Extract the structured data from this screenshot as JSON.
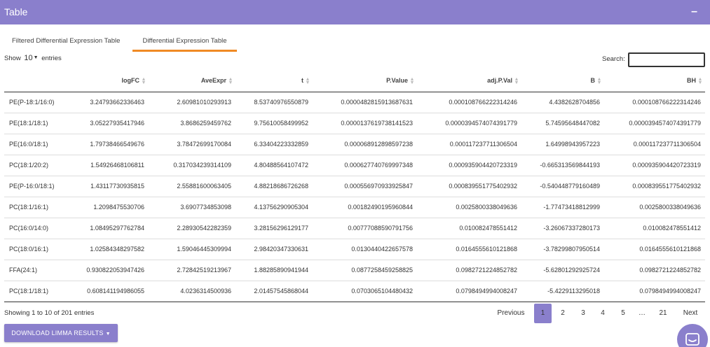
{
  "header": {
    "title": "Table",
    "collapse_icon": "minus"
  },
  "tabs": [
    {
      "label": "Filtered Differential Expression Table",
      "active": false
    },
    {
      "label": "Differential Expression Table",
      "active": true
    }
  ],
  "length_menu": {
    "prefix": "Show",
    "value": "10",
    "suffix": "entries"
  },
  "search": {
    "label": "Search:",
    "value": ""
  },
  "table": {
    "columns": [
      "",
      "logFC",
      "AveExpr",
      "t",
      "P.Value",
      "adj.P.Val",
      "B",
      "BH"
    ],
    "rows": [
      [
        "PE(P-18:1/16:0)",
        "3.24793662336463",
        "2.60981010293913",
        "8.53740976550879",
        "0.0000482815913687631",
        "0.000108766222314246",
        "4.4382628704856",
        "0.000108766222314246"
      ],
      [
        "PE(18:1/18:1)",
        "3.05227935417946",
        "3.8686259459762",
        "9.75610058499952",
        "0.0000137619738141523",
        "0.0000394574074391779",
        "5.74595648447082",
        "0.0000394574074391779"
      ],
      [
        "PE(16:0/18:1)",
        "1.79738466549676",
        "3.78472699170084",
        "6.33404223332859",
        "0.000068912898597238",
        "0.000117237711306504",
        "1.64998943957223",
        "0.000117237711306504"
      ],
      [
        "PC(18:1/20:2)",
        "1.54926468106811",
        "0.317034239314109",
        "4.80488564107472",
        "0.000627740769997348",
        "0.000935904420723319",
        "-0.665313569844193",
        "0.000935904420723319"
      ],
      [
        "PE(P-16:0/18:1)",
        "1.43117730935815",
        "2.55881600063405",
        "4.88218686726268",
        "0.000556970933925847",
        "0.000839551775402932",
        "-0.540448779160489",
        "0.000839551775402932"
      ],
      [
        "PC(18:1/16:1)",
        "1.2098475530706",
        "3.6907734853098",
        "4.13756290905304",
        "0.00182490195960844",
        "0.0025800338049636",
        "-1.77473418812999",
        "0.0025800338049636"
      ],
      [
        "PC(16:0/14:0)",
        "1.08495297762784",
        "2.28930542282359",
        "3.28156296129177",
        "0.00777088590791756",
        "0.010082478551412",
        "-3.26067337280173",
        "0.010082478551412"
      ],
      [
        "PC(18:0/16:1)",
        "1.02584348297582",
        "1.59046445309994",
        "2.98420347330631",
        "0.0130440422657578",
        "0.0164555610121868",
        "-3.78299807950514",
        "0.0164555610121868"
      ],
      [
        "FFA(24:1)",
        "0.930822053947426",
        "2.72842519213967",
        "1.88285890941944",
        "0.0877258459258825",
        "0.0982721224852782",
        "-5.62801292925724",
        "0.0982721224852782"
      ],
      [
        "PC(18:1/18:1)",
        "0.608141194986055",
        "4.0236314500936",
        "2.01457545868044",
        "0.0703065104480432",
        "0.0798494994008247",
        "-5.4229113295018",
        "0.0798494994008247"
      ]
    ]
  },
  "info": "Showing 1 to 10 of 201 entries",
  "pagination": {
    "previous": "Previous",
    "pages": [
      "1",
      "2",
      "3",
      "4",
      "5",
      "…",
      "21"
    ],
    "current": "1",
    "next": "Next"
  },
  "download_button": {
    "label": "DOWNLOAD LIMMA RESULTS"
  },
  "colors": {
    "accent": "#8a7fcc",
    "tab_underline": "#f08a24"
  }
}
